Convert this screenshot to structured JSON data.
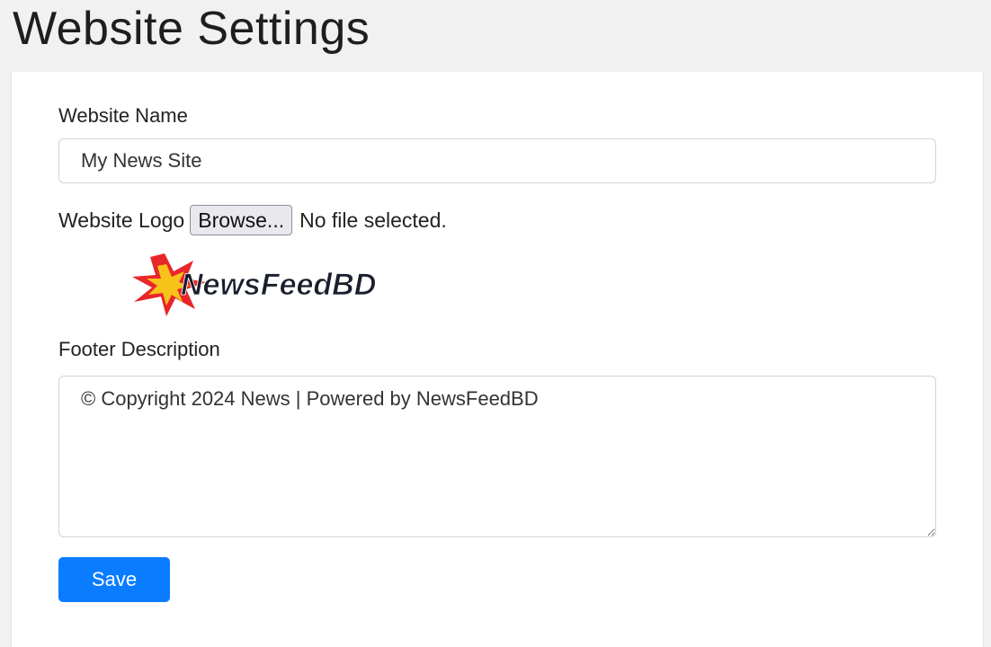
{
  "page": {
    "title": "Website Settings"
  },
  "form": {
    "website_name_label": "Website Name",
    "website_name_value": "My News Site",
    "website_logo_label": "Website Logo",
    "browse_label": "Browse...",
    "file_status": "No file selected.",
    "logo_text": "NewsFeedBD",
    "footer_label": "Footer Description",
    "footer_value": "© Copyright 2024 News | Powered by NewsFeedBD",
    "save_label": "Save"
  },
  "colors": {
    "page_background": "#f1f1f1",
    "card_background": "#ffffff",
    "primary_button": "#0a7cff",
    "logo_burst_outer": "#e8262b",
    "logo_burst_inner": "#f7c21a"
  }
}
